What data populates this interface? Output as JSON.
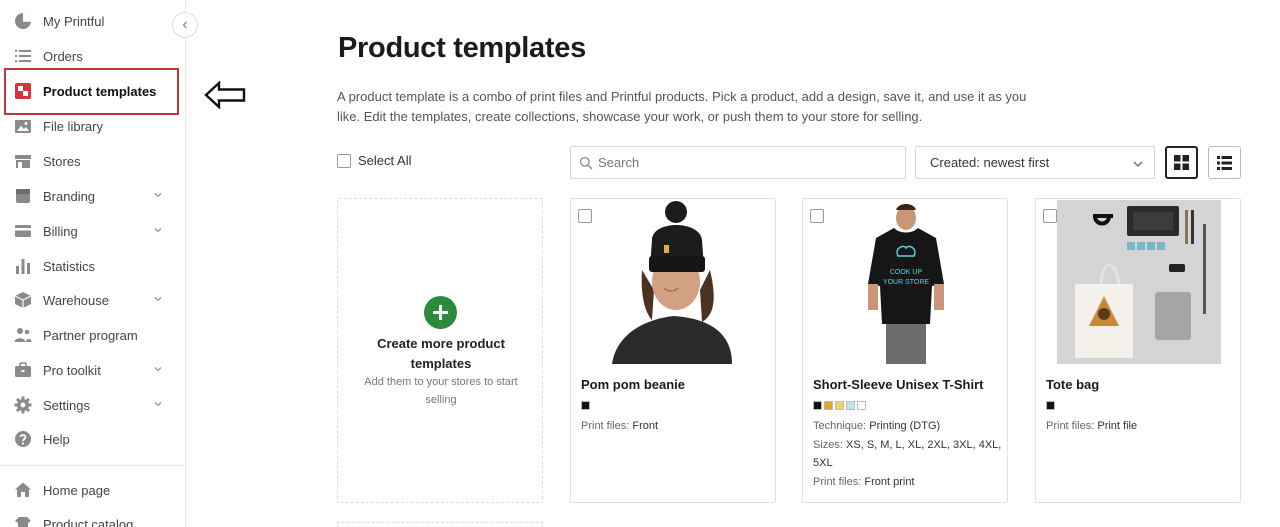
{
  "sidebar": {
    "items": [
      {
        "label": "My Printful",
        "icon": "pie-chart-icon",
        "chevron": false
      },
      {
        "label": "Orders",
        "icon": "list-icon",
        "chevron": false
      },
      {
        "label": "Product templates",
        "icon": "product-templates-icon",
        "chevron": false,
        "active": true
      },
      {
        "label": "File library",
        "icon": "image-icon",
        "chevron": false
      },
      {
        "label": "Stores",
        "icon": "store-icon",
        "chevron": false
      },
      {
        "label": "Branding",
        "icon": "branding-icon",
        "chevron": true
      },
      {
        "label": "Billing",
        "icon": "credit-card-icon",
        "chevron": true
      },
      {
        "label": "Statistics",
        "icon": "bar-chart-icon",
        "chevron": false
      },
      {
        "label": "Warehouse",
        "icon": "box-icon",
        "chevron": true
      },
      {
        "label": "Partner program",
        "icon": "people-icon",
        "chevron": false
      },
      {
        "label": "Pro toolkit",
        "icon": "briefcase-icon",
        "chevron": true
      },
      {
        "label": "Settings",
        "icon": "gear-icon",
        "chevron": true
      },
      {
        "label": "Help",
        "icon": "help-icon",
        "chevron": false
      }
    ],
    "bottom_items": [
      {
        "label": "Home page",
        "icon": "home-icon"
      },
      {
        "label": "Product catalog",
        "icon": "catalog-icon"
      }
    ]
  },
  "main": {
    "title": "Product templates",
    "intro": "A product template is a combo of print files and Printful products. Pick a product, add a design, save it, and use it as you like. Edit the templates, create collections, showcase your work, or push them to your store for selling.",
    "select_all": "Select All",
    "search_placeholder": "Search",
    "sort_value": "Created: newest first",
    "create_card": {
      "title": "Create more product templates",
      "subtitle": "Add them to your stores to start selling"
    },
    "products": [
      {
        "name": "Pom pom beanie",
        "colors": [
          "#111111"
        ],
        "print_files_label": "Print files:",
        "print_files": "Front"
      },
      {
        "name": "Short-Sleeve Unisex T-Shirt",
        "colors": [
          "#111111",
          "#e8a21c",
          "#f2d36a",
          "#bfe3ea",
          "#ffffff"
        ],
        "technique_label": "Technique:",
        "technique": "Printing (DTG)",
        "sizes_label": "Sizes:",
        "sizes": "XS, S, M, L, XL, 2XL, 3XL, 4XL, 5XL",
        "print_files_label": "Print files:",
        "print_files": "Front print"
      },
      {
        "name": "Tote bag",
        "colors": [
          "#111111"
        ],
        "print_files_label": "Print files:",
        "print_files": "Print file"
      }
    ]
  },
  "colors": {
    "accent_green": "#2c8a3c",
    "highlight_red": "#c0343b"
  }
}
